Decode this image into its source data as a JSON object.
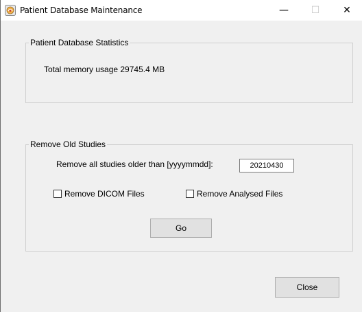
{
  "window": {
    "title": "Patient Database Maintenance",
    "minimize": "—",
    "maximize": "☐",
    "close": "✕"
  },
  "statistics": {
    "legend": "Patient Database Statistics",
    "memory_usage": "Total memory usage 29745.4 MB"
  },
  "remove": {
    "legend": "Remove Old Studies",
    "older_than_label": "Remove all studies older than [yyyymmdd]:",
    "date_value": "20210430",
    "dicom_label": "Remove DICOM Files",
    "dicom_checked": false,
    "analysed_label": "Remove Analysed Files",
    "analysed_checked": false,
    "go_label": "Go"
  },
  "footer": {
    "close_label": "Close"
  }
}
